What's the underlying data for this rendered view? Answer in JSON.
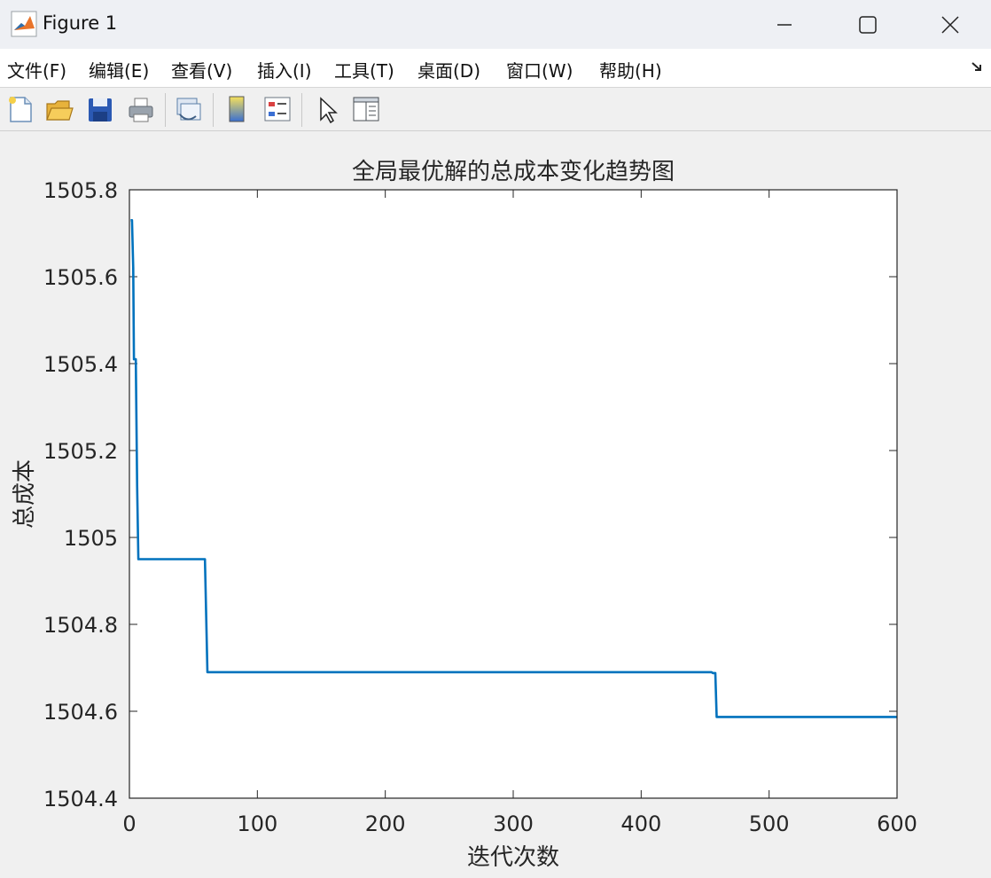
{
  "window": {
    "title": "Figure 1",
    "icon": "matlab-logo-icon",
    "controls": [
      "minimize-icon",
      "maximize-icon",
      "close-icon"
    ]
  },
  "menu": {
    "items": [
      "文件(F)",
      "编辑(E)",
      "查看(V)",
      "插入(I)",
      "工具(T)",
      "桌面(D)",
      "窗口(W)",
      "帮助(H)"
    ],
    "dock_icon": "dock-arrow-icon"
  },
  "toolbar": {
    "tools": [
      "new-figure-icon",
      "open-file-icon",
      "save-icon",
      "print-icon",
      "link-plot-icon",
      "colorbar-icon",
      "legend-icon",
      "edit-plot-pointer-icon",
      "property-inspector-icon"
    ]
  },
  "chart_data": {
    "type": "line",
    "title": "全局最优解的总成本变化趋势图",
    "xlabel": "迭代次数",
    "ylabel": "总成本",
    "xlim": [
      0,
      600
    ],
    "ylim": [
      1504.4,
      1505.8
    ],
    "xticks": [
      "0",
      "100",
      "200",
      "300",
      "400",
      "500",
      "600"
    ],
    "yticks": [
      "1504.4",
      "1504.6",
      "1504.8",
      "1505",
      "1505.2",
      "1505.4",
      "1505.6",
      "1505.8"
    ],
    "grid": false,
    "line_color": "#0072bd",
    "series": [
      {
        "x": [
          1,
          2,
          3,
          3.5,
          4,
          4.5,
          5,
          6,
          7,
          8,
          59,
          60,
          61,
          455,
          456,
          457,
          458,
          459,
          600
        ],
        "y": [
          1505.73,
          1505.73,
          1505.62,
          1505.41,
          1505.41,
          1505.41,
          1505.41,
          1505.12,
          1504.95,
          1504.95,
          1504.95,
          1504.82,
          1504.69,
          1504.69,
          1504.688,
          1504.688,
          1504.688,
          1504.587,
          1504.587
        ]
      }
    ]
  }
}
